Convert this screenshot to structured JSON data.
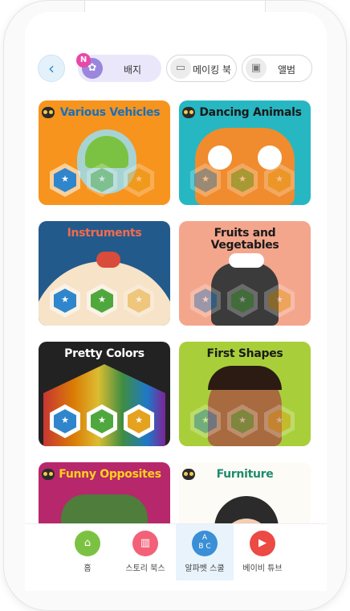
{
  "header": {
    "back_icon": "chevron-left-icon",
    "tabs": [
      {
        "label": "배지",
        "icon": "badge-icon",
        "active": true,
        "new_badge": "N"
      },
      {
        "label": "메이킹 북",
        "icon": "id-card-icon",
        "active": false
      },
      {
        "label": "앨범",
        "icon": "photo-icon",
        "active": false
      }
    ]
  },
  "books": [
    {
      "title": "Various Vehicles",
      "bg": "#f7941d",
      "title_color": "#1c6fb7",
      "badges_earned": 1
    },
    {
      "title": "Dancing Animals",
      "bg": "#26b7c2",
      "title_color": "#1a1a1a",
      "badges_earned": 0
    },
    {
      "title": "Instruments",
      "bg": "#235a8c",
      "title_color": "#f26b4f",
      "badges_earned": 2
    },
    {
      "title": "Fruits and Vegetables",
      "bg": "#f4a68c",
      "title_color": "#1a1a1a",
      "badges_earned": 0
    },
    {
      "title": "Pretty Colors",
      "bg": "#222222",
      "title_color": "#ffffff",
      "badges_earned": 3
    },
    {
      "title": "First Shapes",
      "bg": "#a8cf3a",
      "title_color": "#1a1a1a",
      "badges_earned": 0
    },
    {
      "title": "Funny Opposites",
      "bg": "#b7276b",
      "title_color": "#ffd11a",
      "badges_earned": 0
    },
    {
      "title": "Furniture",
      "bg": "#fdfbf6",
      "title_color": "#1c8c6e",
      "badges_earned": 0
    }
  ],
  "badge_colors": [
    "#2f86cc",
    "#4fa83d",
    "#e5a21f"
  ],
  "bottom_nav": [
    {
      "label": "홈",
      "icon": "home-icon",
      "color": "#7cc242",
      "active": false
    },
    {
      "label": "스토리 북스",
      "icon": "book-icon",
      "color": "#f26178",
      "active": false
    },
    {
      "label": "알파벳 스쿨",
      "icon": "abc-blocks-icon",
      "color": "#3a8fd6",
      "active": true
    },
    {
      "label": "베이비 튜브",
      "icon": "play-icon",
      "color": "#ec4a44",
      "active": false
    }
  ]
}
